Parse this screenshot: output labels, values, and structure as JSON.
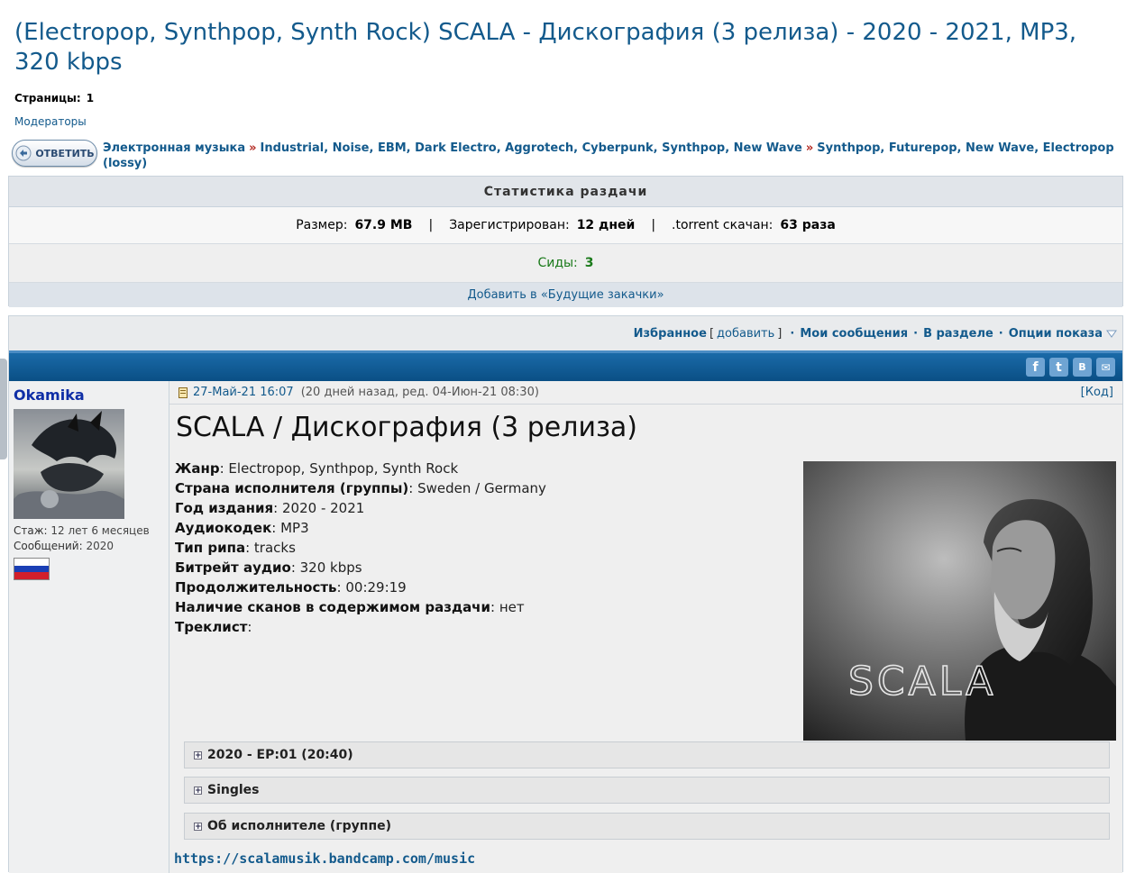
{
  "topic": {
    "title": "(Electropop, Synthpop, Synth Rock) SCALA - Дискография (3 релиза) - 2020 - 2021, MP3, 320 kbps",
    "pages_label": "Страницы:",
    "pages_value": "1",
    "moderators_link": "Модераторы",
    "reply_label": "ОТВЕТИТЬ"
  },
  "breadcrumb": {
    "items": [
      "Электронная музыка",
      "Industrial, Noise, EBM, Dark Electro, Aggrotech, Cyberpunk, Synthpop, New Wave",
      "Synthpop, Futurepop, New Wave, Electropop (lossy)"
    ],
    "separator": "»"
  },
  "stats": {
    "header": "Статистика раздачи",
    "size_label": "Размер:",
    "size_value": "67.9 MB",
    "registered_label": "Зарегистрирован:",
    "registered_value": "12 дней",
    "downloaded_label": ".torrent скачан:",
    "downloaded_value": "63 раза",
    "pipe": "|",
    "seeds_label": "Сиды:",
    "seeds_value": "3",
    "future_downloads": "Добавить в «Будущие закачки»"
  },
  "post_nav": {
    "favorites": "Избранное",
    "bracket_open": "[",
    "add": "добавить",
    "bracket_close": "]",
    "dot": "·",
    "my_messages": "Мои сообщения",
    "in_section": "В разделе",
    "view_options": "Опции показа"
  },
  "share": {
    "facebook": "f",
    "twitter": "t",
    "vk": "B",
    "mail": "✉"
  },
  "user": {
    "name": "Okamika",
    "tenure_label": "Стаж:",
    "tenure_value": "12 лет 6 месяцев",
    "posts_label": "Сообщений:",
    "posts_value": "2020"
  },
  "post": {
    "date": "27-Май-21 16:07",
    "ago": "(20 дней назад, ред. 04-Июн-21 08:30)",
    "code_link": "[Код]",
    "release_title": "SCALA / Дискография (3 релиза)",
    "props": [
      {
        "key": "Жанр",
        "value": "Electropop, Synthpop, Synth Rock"
      },
      {
        "key": "Страна исполнителя (группы)",
        "value": "Sweden / Germany"
      },
      {
        "key": "Год издания",
        "value": "2020 - 2021"
      },
      {
        "key": "Аудиокодек",
        "value": "MP3"
      },
      {
        "key": "Тип рипа",
        "value": "tracks"
      },
      {
        "key": "Битрейт аудио",
        "value": "320 kbps"
      },
      {
        "key": "Продолжительность",
        "value": "00:29:19"
      },
      {
        "key": "Наличие сканов в содержимом раздачи",
        "value": "нет"
      },
      {
        "key": "Треклист",
        "value": ""
      }
    ],
    "cover_logo": "SCALA",
    "spoilers": [
      "2020 - EP:01 (20:40)",
      "Singles",
      "Об исполнителе (группе)"
    ],
    "band_link": "https://scalamusik.bandcamp.com/music"
  },
  "colors": {
    "link": "#135a8c",
    "seeds_green": "#1a7a1a",
    "username_blue": "#0f2ea6",
    "bar_blue": "#0a4f85"
  }
}
